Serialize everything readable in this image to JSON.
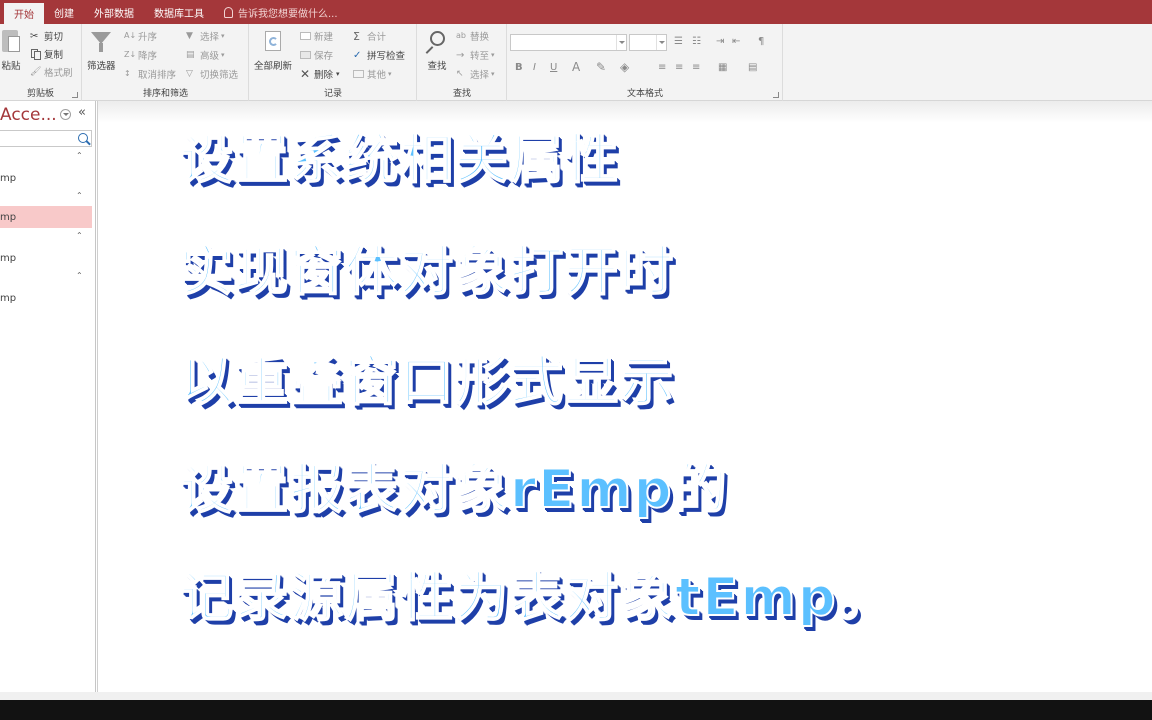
{
  "tabs": [
    {
      "label": "开始",
      "active": true
    },
    {
      "label": "创建",
      "active": false
    },
    {
      "label": "外部数据",
      "active": false
    },
    {
      "label": "数据库工具",
      "active": false
    }
  ],
  "tell_me": "告诉我您想要做什么...",
  "ribbon": {
    "clipboard": {
      "paste": "粘贴",
      "cut": "剪切",
      "copy": "复制",
      "format_painter": "格式刷",
      "label": "剪贴板"
    },
    "sort_filter": {
      "filter": "筛选器",
      "ascending": "升序",
      "descending": "降序",
      "remove_sort": "取消排序",
      "selection": "选择",
      "advanced": "高级",
      "toggle_filter": "切换筛选",
      "label": "排序和筛选"
    },
    "records": {
      "refresh_all": "全部刷新",
      "new": "新建",
      "save": "保存",
      "delete": "删除",
      "totals": "合计",
      "spelling": "拼写检查",
      "more": "其他",
      "label": "记录"
    },
    "find": {
      "find": "查找",
      "replace": "替换",
      "goto": "转至",
      "select": "选择",
      "label": "查找"
    },
    "text_format": {
      "bold": "B",
      "italic": "I",
      "underline": "U",
      "label": "文本格式"
    }
  },
  "nav": {
    "title": "Acce...",
    "items": [
      {
        "label": "mp",
        "selected": false
      },
      {
        "label": "mp",
        "selected": true
      },
      {
        "label": "mp",
        "selected": false
      },
      {
        "label": "mp",
        "selected": false
      }
    ]
  },
  "captions": [
    "设置系统相关属性",
    "实现窗体对象打开时",
    "以重叠窗口形式显示",
    "设置报表对象rEmp的",
    "记录源属性为表对象tEmp。"
  ],
  "colors": {
    "accent": "#a4373a",
    "caption_fill": "#5bc0ff",
    "caption_shadow": "#1e3fa8"
  }
}
